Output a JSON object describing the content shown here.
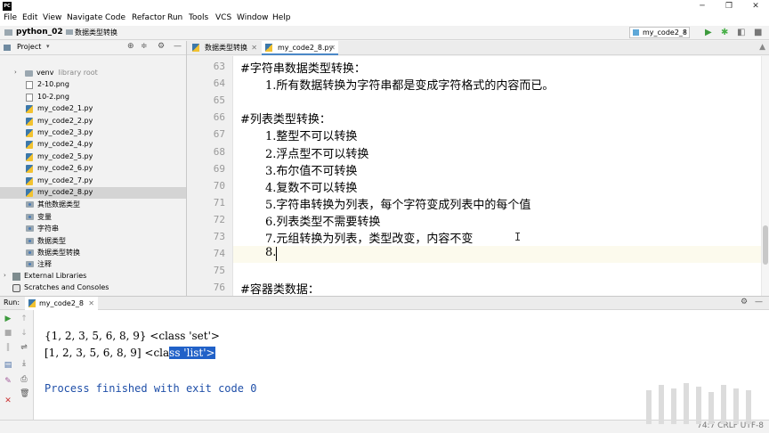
{
  "app": {
    "icon": "PC"
  },
  "window": {
    "minimize": "─",
    "maximize": "❐",
    "close": "✕"
  },
  "menu": [
    "File",
    "Edit",
    "View",
    "Navigate",
    "Code",
    "Refactor",
    "Run",
    "Tools",
    "VCS",
    "Window",
    "Help"
  ],
  "navbar": {
    "project": "python_02",
    "file": "数据类型转换",
    "run_config": "my_code2_8"
  },
  "project_panel": {
    "title": "Project"
  },
  "tree": [
    {
      "label": "venv",
      "sub": "library root",
      "type": "folder",
      "indent": 1,
      "arrow": "›"
    },
    {
      "label": "2-10.png",
      "type": "png",
      "indent": 2
    },
    {
      "label": "10-2.png",
      "type": "png",
      "indent": 2
    },
    {
      "label": "my_code2_1.py",
      "type": "py",
      "indent": 2
    },
    {
      "label": "my_code2_2.py",
      "type": "py",
      "indent": 2
    },
    {
      "label": "my_code2_3.py",
      "type": "py",
      "indent": 2
    },
    {
      "label": "my_code2_4.py",
      "type": "py",
      "indent": 2
    },
    {
      "label": "my_code2_5.py",
      "type": "py",
      "indent": 2
    },
    {
      "label": "my_code2_6.py",
      "type": "py",
      "indent": 2
    },
    {
      "label": "my_code2_7.py",
      "type": "py",
      "indent": 2
    },
    {
      "label": "my_code2_8.py",
      "type": "py",
      "indent": 2,
      "selected": true
    },
    {
      "label": "其他数据类型",
      "type": "pkg",
      "indent": 2
    },
    {
      "label": "变量",
      "type": "pkg",
      "indent": 2
    },
    {
      "label": "字符串",
      "type": "pkg",
      "indent": 2
    },
    {
      "label": "数据类型",
      "type": "pkg",
      "indent": 2
    },
    {
      "label": "数据类型转换",
      "type": "pkg",
      "indent": 2
    },
    {
      "label": "注释",
      "type": "pkg",
      "indent": 2
    },
    {
      "label": "External Libraries",
      "type": "lib",
      "indent": 0,
      "arrow": "›"
    },
    {
      "label": "Scratches and Consoles",
      "type": "scratch",
      "indent": 0
    }
  ],
  "tabs": [
    {
      "label": "数据类型转换",
      "active": false
    },
    {
      "label": "my_code2_8.py",
      "active": true
    }
  ],
  "editor": {
    "lines": [
      {
        "no": "63",
        "text": "#字符串数据类型转换：",
        "indent": 0
      },
      {
        "no": "64",
        "text": "1.所有数据转换为字符串都是变成字符格式的内容而已。",
        "indent": 1
      },
      {
        "no": "65",
        "text": "",
        "indent": 0
      },
      {
        "no": "66",
        "text": "#列表类型转换：",
        "indent": 0
      },
      {
        "no": "67",
        "text": "1.整型不可以转换",
        "indent": 1
      },
      {
        "no": "68",
        "text": "2.浮点型不可以转换",
        "indent": 1
      },
      {
        "no": "69",
        "text": "3.布尔值不可转换",
        "indent": 1
      },
      {
        "no": "70",
        "text": "4.复数不可以转换",
        "indent": 1
      },
      {
        "no": "71",
        "text": "5.字符串转换为列表，每个字符变成列表中的每个值",
        "indent": 1
      },
      {
        "no": "72",
        "text": "6.列表类型不需要转换",
        "indent": 1
      },
      {
        "no": "73",
        "text": "7.元组转换为列表，类型改变，内容不变",
        "indent": 1
      },
      {
        "no": "74",
        "text": "8.",
        "indent": 1
      },
      {
        "no": "75",
        "text": "",
        "indent": 0
      },
      {
        "no": "76",
        "text": "#容器类数据：",
        "indent": 0
      }
    ],
    "current_line": "74"
  },
  "run": {
    "label": "Run:",
    "tab": "my_code2_8",
    "output": [
      {
        "text": "{1, 2, 3, 5, 6, 8, 9} <class 'set'>"
      },
      {
        "pre": "[1, 2, 3, 5, 6, 8, 9] <cla",
        "selected": "ss 'list'>"
      },
      {
        "text": "Process finished with exit code 0",
        "style": "blue"
      }
    ]
  },
  "status": {
    "right": "74:7  CRLF  UTF-8"
  },
  "colors": {
    "accent": "#4a88c7",
    "selection": "#2161c8",
    "run_green": "#3c9a3c",
    "debug_green": "#48b048"
  }
}
